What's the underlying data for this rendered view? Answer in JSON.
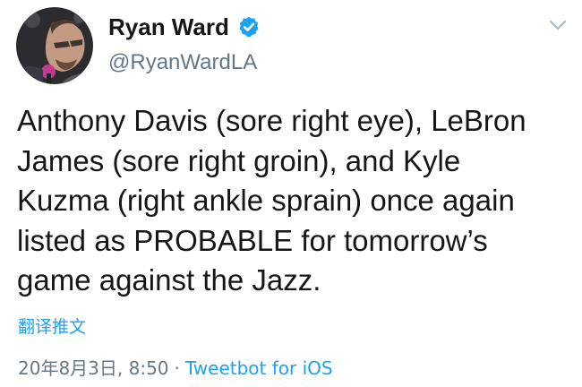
{
  "author": {
    "display_name": "Ryan Ward",
    "handle": "@RyanWardLA",
    "verified": true
  },
  "tweet": {
    "text": "Anthony Davis (sore right eye), LeBron\nJames (sore right groin), and Kyle\nKuzma (right ankle sprain) once again\nlisted as PROBABLE for tomorrow’s\ngame against the Jazz.",
    "translate_label": "翻译推文",
    "timestamp": "20年8月3日, 8:50",
    "separator": "·",
    "client": "Tweetbot for iOS"
  },
  "icons": {
    "verified": "verified-badge-icon",
    "menu": "chevron-down-icon"
  },
  "colors": {
    "link_blue": "#1da1f2",
    "secondary_gray": "#657786",
    "text_dark": "#14171a"
  }
}
